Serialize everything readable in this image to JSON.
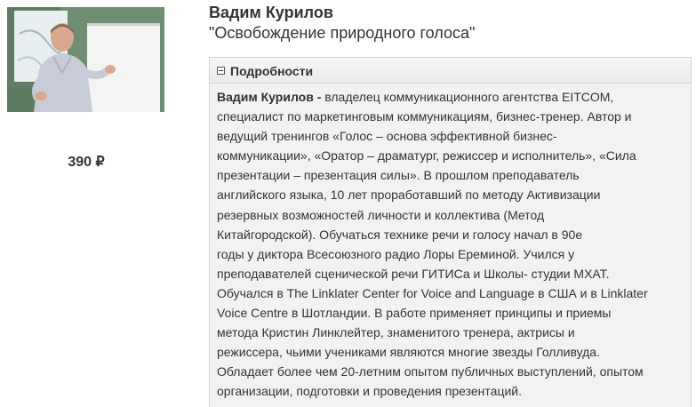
{
  "product": {
    "price": "390 ₽",
    "speaker_name": "Вадим Курилов",
    "course_title": "\"Освобождение природного голоса\"",
    "thumbnail": {
      "presenter_color": "#c8ccd6",
      "background_color": "#6f8f72"
    }
  },
  "details": {
    "toggle_icon": "minus-box-icon",
    "header": "Подробности",
    "bio_name": "Вадим Курилов -",
    "bio_text": " владелец коммуникационного агентства EITCOM,\nспециалист по маркетинговым    коммуникациям, бизнес-тренер. Автор и\nведущий    тренингов «Голос – основа эффективной    бизнес-\nкоммуникации», «Оратор – драматург, режиссер и исполнитель», «Сила\n презентации – презентация    силы». В прошлом преподаватель\n английского языка,    10 лет    проработавший по методу Активизации\nрезервных возможностей    личности и коллектива (Метод\nКитайгородской).    Обучаться    технике речи и    голосу    начал    в 90е\nгоды у диктора    Всесоюзного радио Лоры Ереминой. Учился у\nпреподавателей сценической речи ГИТИСа и Школы- студии МХАТ.\nОбучался в The Linklater Center for Voice and Language в США и в Linklater\nVoice Centre    в Шотландии. В работе применяет принципы и приемы\nметода Кристин    Линклейтер,    знаменитого    тренера, актрисы и\nрежиссера, чьими учениками    являются многие звезды Голливуда.\nОбладает более чем 20-летним опытом публичных выступлений, опытом\nорганизации, подготовки и проведения презентаций."
  }
}
